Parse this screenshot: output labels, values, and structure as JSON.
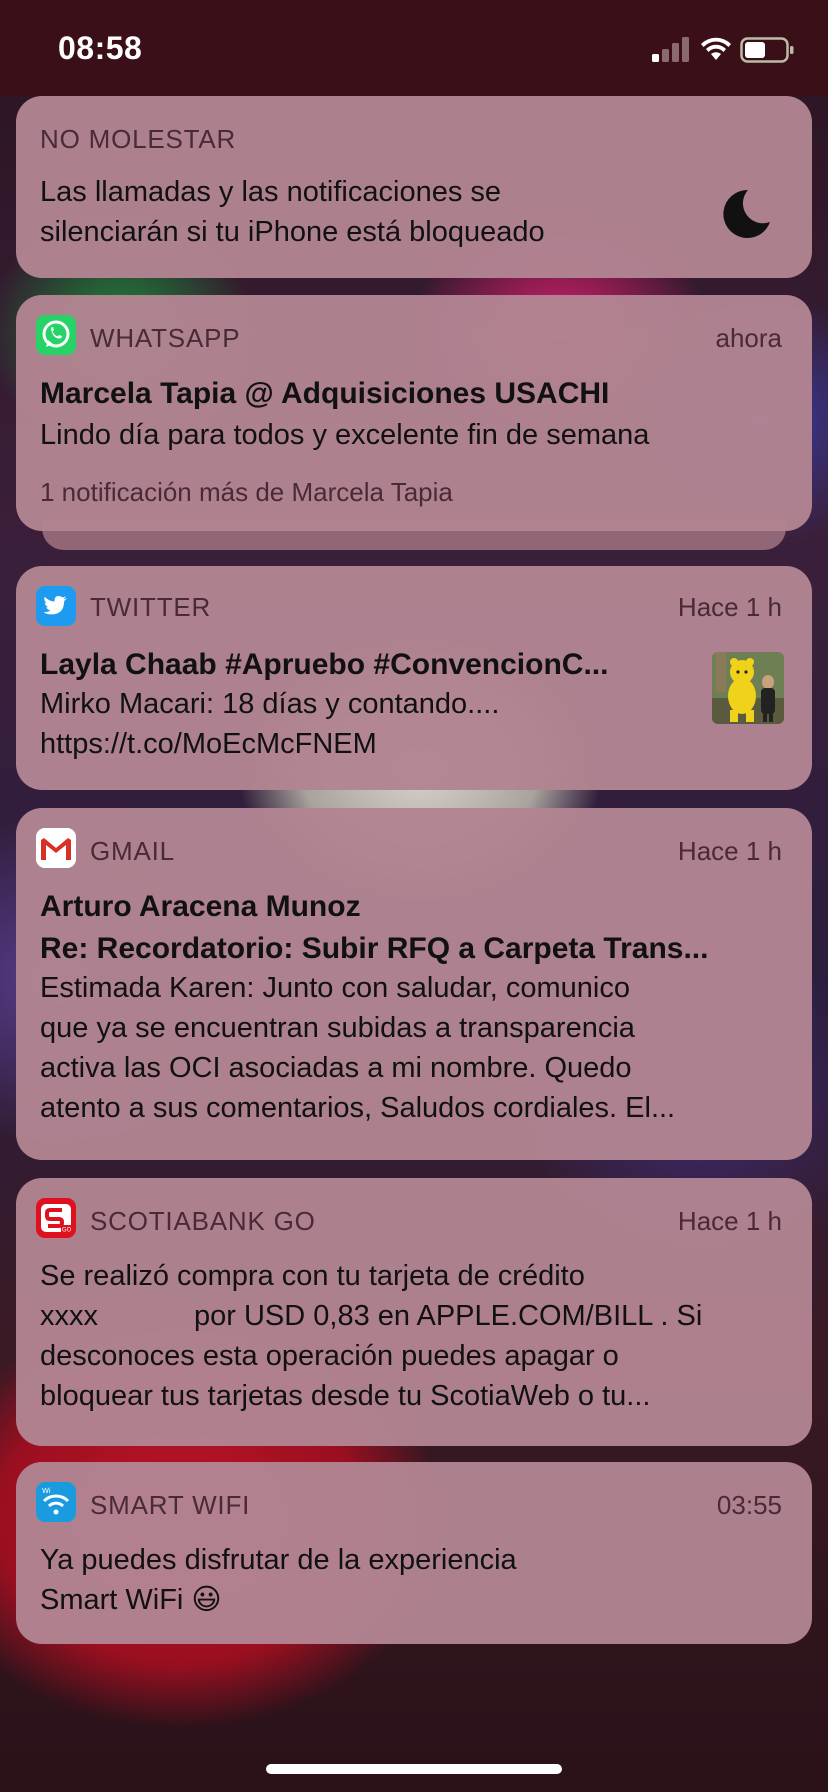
{
  "status_bar": {
    "time": "08:58",
    "icons": [
      "cellular-signal-icon",
      "wifi-icon",
      "battery-icon"
    ]
  },
  "dnd": {
    "header": "NO MOLESTAR",
    "text_line1": "Las llamadas y las notificaciones se",
    "text_line2": "silenciarán si tu iPhone está bloqueado",
    "icon": "moon-icon"
  },
  "notifications": [
    {
      "app": "WHATSAPP",
      "time": "ahora",
      "icon": "whatsapp-icon",
      "title": "Marcela Tapia @ Adquisiciones USACHI",
      "body": "Lindo día para todos y excelente fin de semana",
      "more": "1 notificación más de Marcela Tapia"
    },
    {
      "app": "TWITTER",
      "time": "Hace 1 h",
      "icon": "twitter-icon",
      "title": "Layla Chaab #Apruebo #ConvencionC...",
      "body_line1": "Mirko Macari: 18 días y contando....",
      "body_line2": "https://t.co/MoEcMcFNEM",
      "thumbnail": "mascot-photo"
    },
    {
      "app": "GMAIL",
      "time": "Hace 1 h",
      "icon": "gmail-icon",
      "title": "Arturo Aracena Munoz",
      "subtitle": "Re: Recordatorio: Subir RFQ a Carpeta Trans...",
      "body_line1": "Estimada Karen: Junto con saludar, comunico",
      "body_line2": "que ya se encuentran subidas a transparencia",
      "body_line3": "activa las OCI asociadas a mi nombre. Quedo",
      "body_line4": "atento a sus comentarios, Saludos cordiales. El..."
    },
    {
      "app": "SCOTIABANK GO",
      "time": "Hace 1 h",
      "icon": "scotiabank-icon",
      "body_line1": "Se realizó compra con tu tarjeta de crédito",
      "body_line2a": "xxxx",
      "body_line2b": "por USD 0,83 en APPLE.COM/BILL . Si",
      "body_line3": "desconoces esta operación puedes apagar o",
      "body_line4": "bloquear tus tarjetas desde tu ScotiaWeb o tu..."
    },
    {
      "app": "SMART WIFI",
      "time": "03:55",
      "icon": "smart-wifi-icon",
      "body_line1": "Ya puedes disfrutar de la experiencia",
      "body_line2": "Smart WiFi 😃"
    }
  ],
  "colors": {
    "card": "#b28492",
    "status_bar": "#3a0f17",
    "whatsapp": "#25d366",
    "twitter": "#1d9bf0",
    "gmail_red": "#d93025",
    "scotiabank": "#e0101e",
    "smartwifi": "#1a9be0"
  }
}
